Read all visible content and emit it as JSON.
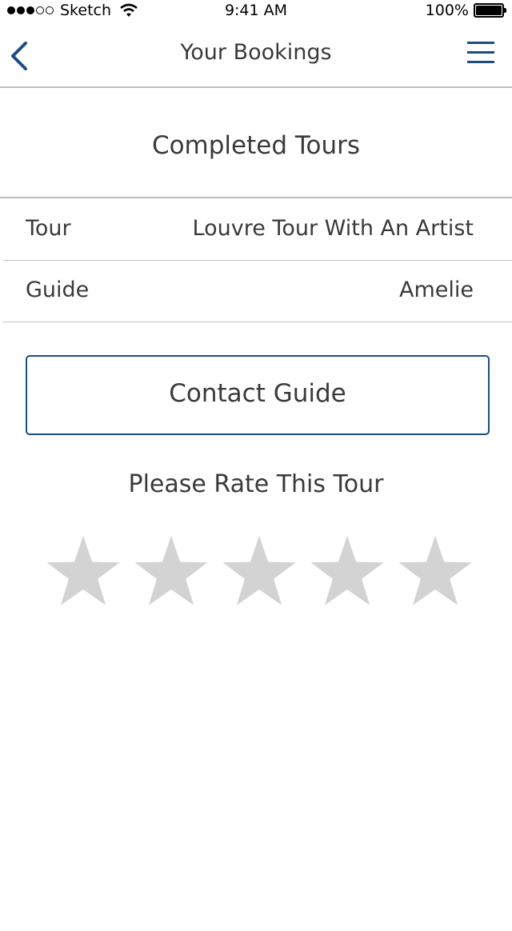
{
  "status_bar": {
    "carrier": "Sketch",
    "time": "9:41 AM",
    "battery": "100%",
    "signal_strength": 3,
    "signal_max": 5
  },
  "nav": {
    "title": "Your Bookings",
    "back_icon": "chevron-left-icon",
    "menu_icon": "hamburger-menu-icon",
    "accent_color": "#1b4d80"
  },
  "section": {
    "title": "Completed Tours"
  },
  "details": [
    {
      "label": "Tour",
      "value": "Louvre Tour With An Artist"
    },
    {
      "label": "Guide",
      "value": "Amelie"
    }
  ],
  "contact_button": {
    "label": "Contact Guide"
  },
  "rating": {
    "prompt": "Please Rate This Tour",
    "value": 0,
    "max": 5,
    "empty_color": "#d3d3d3"
  }
}
